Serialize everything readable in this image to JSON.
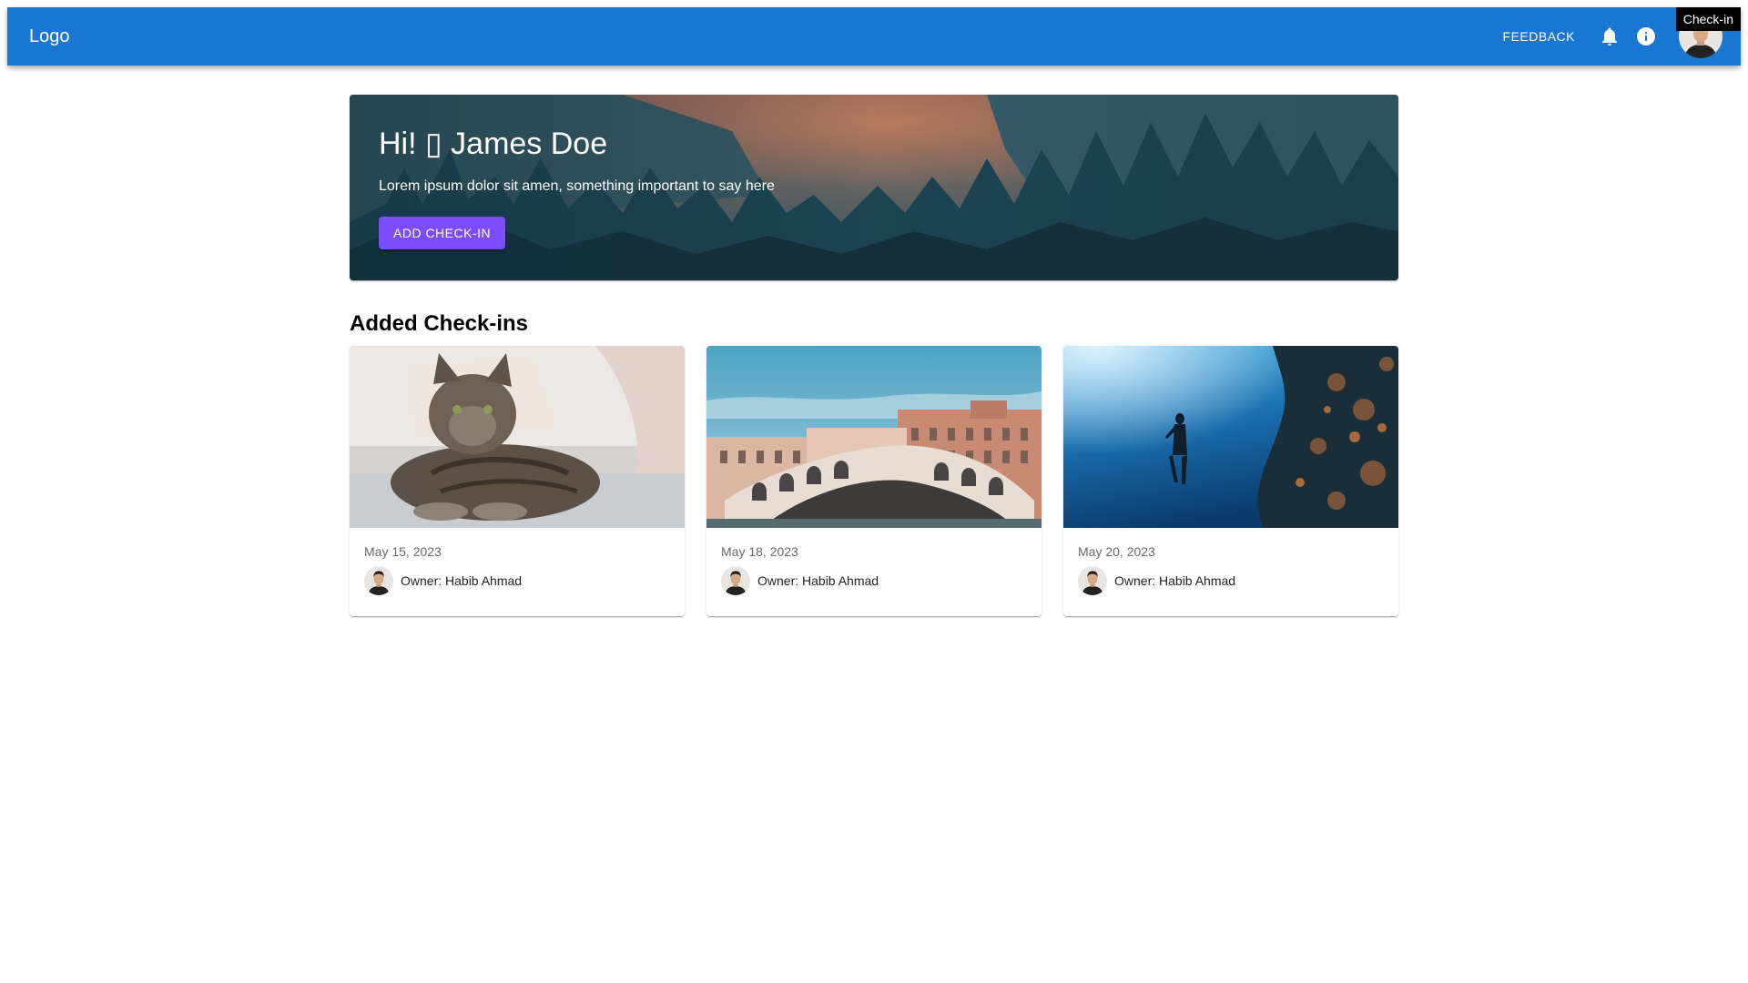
{
  "appbar": {
    "logo": "Logo",
    "feedback_label": "FEEDBACK",
    "color": "#1976d2",
    "icons": [
      "bell-icon",
      "info-icon"
    ],
    "tooltip": "Check-in"
  },
  "hero": {
    "title": "Hi! ▯ James Doe",
    "subtitle": "Lorem ipsum dolor sit amen, something important to say here",
    "button_label": "ADD CHECK-IN",
    "button_color": "#7c4dff"
  },
  "checkins": {
    "title": "Added Check-ins",
    "cards": [
      {
        "image": "cat-photo",
        "date": "May 15, 2023",
        "owner": "Owner: Habib Ahmad"
      },
      {
        "image": "venice-bridge-photo",
        "date": "May 18, 2023",
        "owner": "Owner: Habib Ahmad"
      },
      {
        "image": "underwater-diver-photo",
        "date": "May 20, 2023",
        "owner": "Owner: Habib Ahmad"
      }
    ]
  }
}
